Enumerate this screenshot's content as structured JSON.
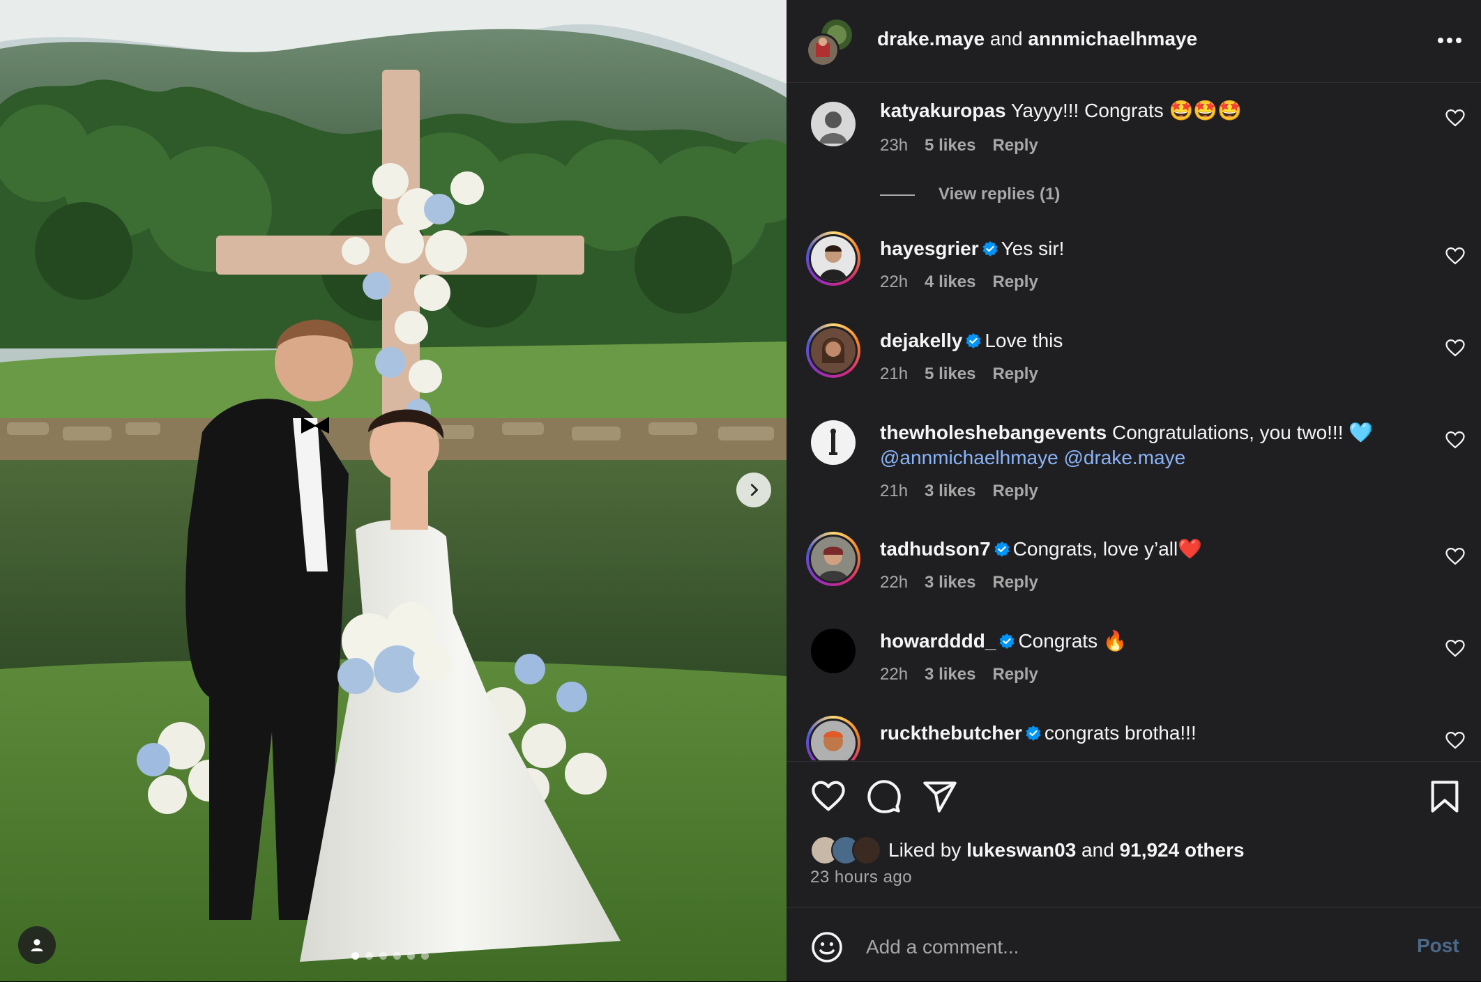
{
  "header": {
    "user1": "drake.maye",
    "conj": " and ",
    "user2": "annmichaelhmaye",
    "more_icon": "more-horizontal-icon"
  },
  "photo": {
    "carousel_dots": 6,
    "active_dot": 0
  },
  "comments": [
    {
      "user": "katyakuropas",
      "verified": false,
      "text": " Yayyy!!! Congrats 🤩🤩🤩",
      "time": "23h",
      "likes": "5 likes",
      "reply": "Reply"
    },
    {
      "user": "hayesgrier",
      "verified": true,
      "text": "Yes sir!",
      "time": "22h",
      "likes": "4 likes",
      "reply": "Reply"
    },
    {
      "user": "dejakelly",
      "verified": true,
      "text": "Love this",
      "time": "21h",
      "likes": "5 likes",
      "reply": "Reply"
    },
    {
      "user": "thewholeshebangevents",
      "verified": false,
      "text": " Congratulations, you two!!! 🩵",
      "mention1": "@annmichaelhmaye",
      "mention2": "@drake.maye",
      "time": "21h",
      "likes": "3 likes",
      "reply": "Reply"
    },
    {
      "user": "tadhudson7",
      "verified": true,
      "text": "Congrats, love y’all❤️",
      "time": "22h",
      "likes": "3 likes",
      "reply": "Reply"
    },
    {
      "user": "howardddd_",
      "verified": true,
      "text": "Congrats 🔥",
      "time": "22h",
      "likes": "3 likes",
      "reply": "Reply"
    },
    {
      "user": "ruckthebutcher",
      "verified": true,
      "text": "congrats brotha!!!",
      "time": "",
      "likes": "",
      "reply": ""
    }
  ],
  "view_replies": "View replies (1)",
  "likes": {
    "prefix": "Liked by ",
    "user": "lukeswan03",
    "middle": " and ",
    "count": "91,924 others"
  },
  "time_ago": "23 hours ago",
  "add_comment": {
    "placeholder": "Add a comment...",
    "post": "Post"
  },
  "colors": {
    "panel_bg": "#1f1f22",
    "text": "#f5f5f5",
    "muted": "#a8a8a8",
    "verified": "#0095f6",
    "mention": "#8ab4f8",
    "post": "#4b6a8a"
  }
}
